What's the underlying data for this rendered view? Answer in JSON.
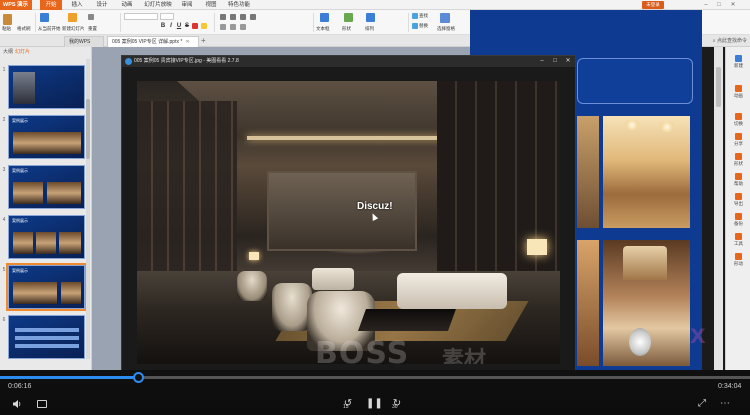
{
  "menubar": {
    "app_label": "WPS 演示",
    "tabs": [
      {
        "label": "开始",
        "active": true
      },
      {
        "label": "插入",
        "active": false
      },
      {
        "label": "设计",
        "active": false
      },
      {
        "label": "动画",
        "active": false
      },
      {
        "label": "幻灯片放映",
        "active": false
      },
      {
        "label": "审阅",
        "active": false
      },
      {
        "label": "视图",
        "active": false
      },
      {
        "label": "特色功能",
        "active": false
      }
    ],
    "login_label": "未登录"
  },
  "ribbon": {
    "paste_label": "粘贴",
    "format_painter_label": "格式刷",
    "from_current_label": "从当前开始",
    "new_slide_label": "新建幻灯片",
    "reset_label": "重置",
    "font_name": "",
    "font_size": "",
    "bold": "B",
    "italic": "I",
    "underline": "U",
    "strike": "S",
    "text_box_label": "文本框",
    "shape_label": "形状",
    "arrange_label": "排列",
    "find_label": "查找",
    "replace_label": "替换",
    "select_pane_label": "选择窗格"
  },
  "doctabs": [
    {
      "label": "我的WPS",
      "active": false
    },
    {
      "label": "005 案例05 VIP专区 详解.pptx *",
      "active": true
    }
  ],
  "tabbar_right": "点此查找命令",
  "thumbs": {
    "header_left": "大纲",
    "header_right": "幻灯片",
    "slides": [
      {
        "num": "1",
        "title": "",
        "selected": false
      },
      {
        "num": "2",
        "title": "案例展示",
        "selected": false
      },
      {
        "num": "3",
        "title": "案例展示",
        "selected": false
      },
      {
        "num": "4",
        "title": "案例展示",
        "selected": false
      },
      {
        "num": "5",
        "title": "案例展示",
        "selected": true
      },
      {
        "num": "6",
        "title": "",
        "selected": false
      }
    ]
  },
  "taskpane": [
    {
      "label": "新建",
      "icon": "new-icon",
      "color": "#3a7fd5"
    },
    {
      "label": "动画",
      "icon": "animation-icon",
      "color": "#e8661b"
    },
    {
      "label": "切换",
      "icon": "transition-icon",
      "color": "#e8661b"
    },
    {
      "label": "分享",
      "icon": "share-icon",
      "color": "#e8661b"
    },
    {
      "label": "形状",
      "icon": "shape-icon",
      "color": "#e8661b"
    },
    {
      "label": "帮助",
      "icon": "help-icon",
      "color": "#e8661b"
    },
    {
      "label": "导出",
      "icon": "export-icon",
      "color": "#e8661b"
    },
    {
      "label": "备份",
      "icon": "backup-icon",
      "color": "#e8661b"
    },
    {
      "label": "工具",
      "icon": "tools-icon",
      "color": "#e8661b"
    },
    {
      "label": "形动",
      "icon": "motion-icon",
      "color": "#e8661b"
    }
  ],
  "viewer": {
    "title": "005 案例05 贵宾接VIP专区.jpg - 美图看看 2.7.8",
    "overlay_text": "Discuz!",
    "watermark": "BOSS",
    "watermark_cn": "素材"
  },
  "player": {
    "elapsed": "0:06:16",
    "total": "0:34:04",
    "progress": 0.184,
    "rewind_seconds": "15",
    "forward_seconds": "30"
  },
  "colors": {
    "accent": "#e8661b",
    "player_accent": "#2d8cf0",
    "slide_blue": "#0e3b91"
  }
}
